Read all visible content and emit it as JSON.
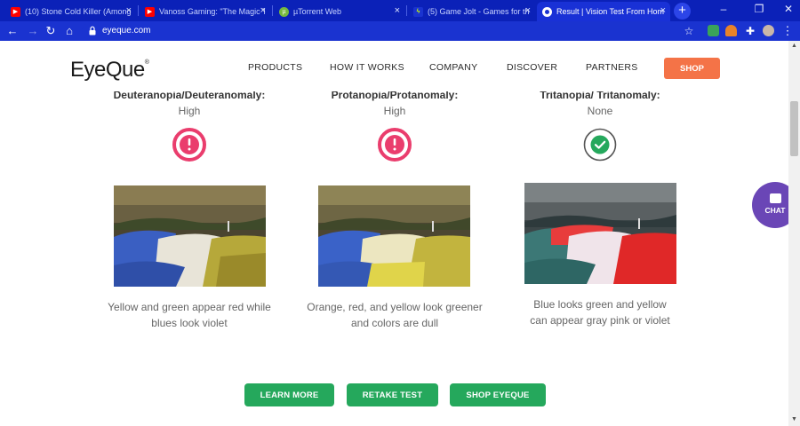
{
  "browser": {
    "tabs": [
      {
        "title": "(10) Stone Cold Killer (Among",
        "favicon": "youtube-icon",
        "color": "#ff0000"
      },
      {
        "title": "Vanoss Gaming: \"The Magic Tr",
        "favicon": "youtube-icon",
        "color": "#ff0000"
      },
      {
        "title": "µTorrent Web",
        "favicon": "utorrent-icon",
        "color": "#76b83f"
      },
      {
        "title": "(5) Game Jolt - Games for the",
        "favicon": "gamejolt-icon",
        "color": "#ccff00"
      },
      {
        "title": "Result | Vision Test From Hom",
        "favicon": "eyeque-icon",
        "color": "#ffffff"
      }
    ],
    "new_tab": "+",
    "url": "eyeque.com"
  },
  "site": {
    "logo": "EyeQue",
    "logo_mark": "®",
    "nav": [
      "PRODUCTS",
      "HOW IT WORKS",
      "COMPANY",
      "DISCOVER",
      "PARTNERS"
    ],
    "shop_label": "SHOP",
    "chat_label": "CHAT"
  },
  "results": [
    {
      "type": "Deuteranopia/Deuteranomaly:",
      "severity": "High",
      "status": "warning",
      "description": "Yellow and green appear red while blues look violet"
    },
    {
      "type": "Protanopia/Protanomaly:",
      "severity": "High",
      "status": "warning",
      "description": "Orange, red, and yellow look greener and colors are dull"
    },
    {
      "type": "Tritanopia/ Tritanomaly:",
      "severity": "None",
      "status": "ok",
      "description": "Blue looks green and yellow can appear gray pink or violet"
    }
  ],
  "buttons": {
    "learn_more": "LEARN MORE",
    "retake_test": "RETAKE TEST",
    "shop_eyeque": "SHOP EYEQUE"
  },
  "colors": {
    "accent_green": "#25a85c",
    "warning_pink": "#ea3d6d",
    "shop_orange": "#f47347",
    "chat_purple": "#6a46b6",
    "browser_blue": "#1a33d0"
  }
}
